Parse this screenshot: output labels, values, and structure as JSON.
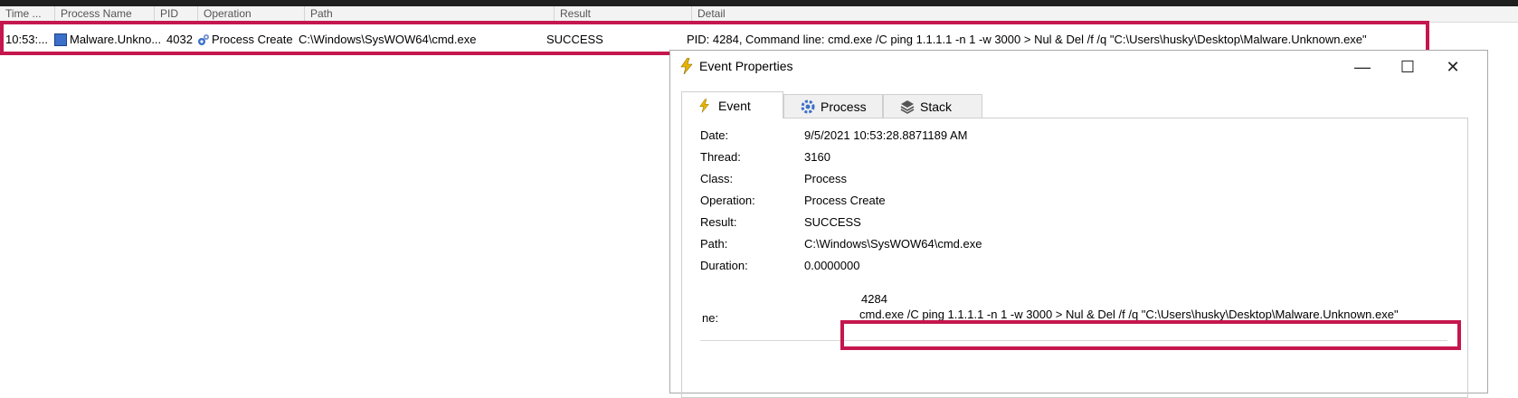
{
  "columns": [
    "Time ...",
    "Process Name",
    "PID",
    "Operation",
    "Path",
    "Result",
    "Detail"
  ],
  "row": {
    "time": "10:53:...",
    "process_name": "Malware.Unkno...",
    "pid": "4032",
    "operation": "Process Create",
    "path": "C:\\Windows\\SysWOW64\\cmd.exe",
    "result": "SUCCESS",
    "detail": "PID: 4284, Command line: cmd.exe /C ping 1.1.1.1 -n 1 -w 3000 > Nul & Del /f /q \"C:\\Users\\husky\\Desktop\\Malware.Unknown.exe\""
  },
  "dialog": {
    "title": "Event Properties",
    "tabs": [
      "Event",
      "Process",
      "Stack"
    ],
    "fields": [
      {
        "label": "Date:",
        "value": "9/5/2021 10:53:28.8871189 AM"
      },
      {
        "label": "Thread:",
        "value": "3160"
      },
      {
        "label": "Class:",
        "value": "Process"
      },
      {
        "label": "Operation:",
        "value": "Process Create"
      },
      {
        "label": "Result:",
        "value": "SUCCESS"
      },
      {
        "label": "Path:",
        "value": "C:\\Windows\\SysWOW64\\cmd.exe"
      },
      {
        "label": "Duration:",
        "value": "0.0000000"
      }
    ],
    "detail_pid": "4284",
    "detail_label": "ne:",
    "detail_command": "cmd.exe /C ping 1.1.1.1 -n 1 -w 3000 > Nul & Del /f /q \"C:\\Users\\husky\\Desktop\\Malware.Unknown.exe\""
  },
  "colors": {
    "highlight": "#c5164d",
    "accent": "#3b6fc9"
  }
}
